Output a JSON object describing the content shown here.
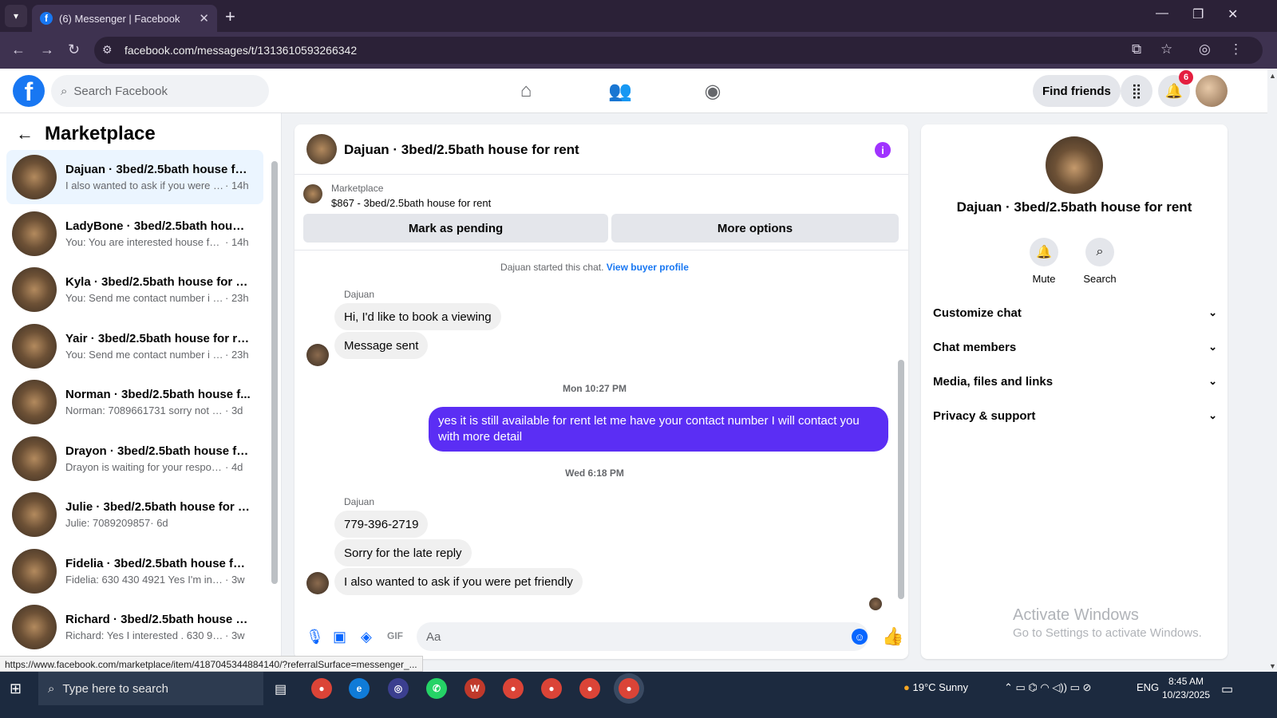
{
  "browser": {
    "tab_title": "(6) Messenger | Facebook",
    "url": "facebook.com/messages/t/1313610593266342",
    "status_url": "https://www.facebook.com/marketplace/item/4187045344884140/?referralSurface=messenger_..."
  },
  "header": {
    "search_placeholder": "Search Facebook",
    "find_friends": "Find friends",
    "notification_count": "6"
  },
  "sidebar": {
    "title": "Marketplace",
    "conversations": [
      {
        "name": "Dajuan · 3bed/2.5bath house for...",
        "preview": "I also wanted to ask if you were p...",
        "time": " · 14h"
      },
      {
        "name": "LadyBone · 3bed/2.5bath house ...",
        "preview": "You: You are interested house for ...",
        "time": " · 14h"
      },
      {
        "name": "Kyla · 3bed/2.5bath house for rent",
        "preview": "You: Send me contact number i wi...",
        "time": " · 23h"
      },
      {
        "name": "Yair · 3bed/2.5bath house for rent",
        "preview": "You: Send me contact number i wi...",
        "time": " · 23h"
      },
      {
        "name": "Norman · 3bed/2.5bath house f...",
        "preview": "Norman: 7089661731 sorry not on ...",
        "time": " · 3d"
      },
      {
        "name": "Drayon · 3bed/2.5bath house fo...",
        "preview": "Drayon is waiting for your response.",
        "time": " · 4d"
      },
      {
        "name": "Julie · 3bed/2.5bath house for re...",
        "preview": "Julie: 7089209857",
        "time": " · 6d"
      },
      {
        "name": "Fidelia · 3bed/2.5bath house for ...",
        "preview": "Fidelia: 630 430 4921 Yes I'm intere...",
        "time": " · 3w"
      },
      {
        "name": "Richard · 3bed/2.5bath house fo...",
        "preview": "Richard: Yes I interested . 630 997 2...",
        "time": " · 3w"
      }
    ]
  },
  "chat": {
    "title": "Dajuan · 3bed/2.5bath house for rent",
    "marketplace_label": "Marketplace",
    "listing": "$867 - 3bed/2.5bath house for rent",
    "mark_pending": "Mark as pending",
    "more_options": "More options",
    "started_text": "Dajuan started this chat.",
    "view_buyer": "View buyer profile",
    "sender1": "Dajuan",
    "msg1": "Hi, I'd like to book a viewing",
    "msg2": "Message sent",
    "stamp1": "Mon 10:27 PM",
    "msg_out": "yes it is still available for rent let me have your contact number I will contact you with more detail",
    "stamp2": "Wed 6:18 PM",
    "sender2": "Dajuan",
    "msg3": "779-396-2719",
    "msg4": "Sorry for the late reply",
    "msg5": "I also wanted to ask if you were pet friendly",
    "composer_placeholder": "Aa"
  },
  "details": {
    "name": "Dajuan · 3bed/2.5bath house for rent",
    "mute": "Mute",
    "search": "Search",
    "sections": [
      "Customize chat",
      "Chat members",
      "Media, files and links",
      "Privacy & support"
    ],
    "watermark_title": "Activate Windows",
    "watermark_sub": "Go to Settings to activate Windows."
  },
  "taskbar": {
    "search_placeholder": "Type here to search",
    "weather": "19°C  Sunny",
    "lang": "ENG",
    "time": "8:45 AM",
    "date": "10/23/2025"
  },
  "colors": {
    "accent": "#1877f2",
    "outgoing_bubble": "#5b2ef4",
    "badge": "#e41e3f"
  }
}
